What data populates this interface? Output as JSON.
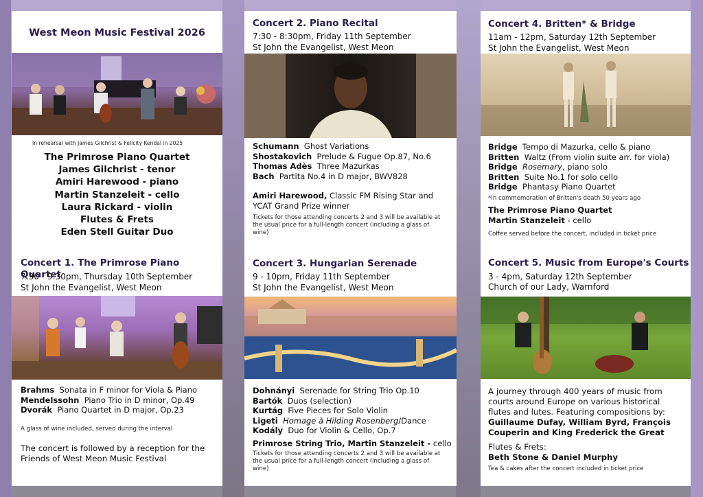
{
  "festival_title": "West Meon Music Festival 2026",
  "rehearsal_caption": "In rehearsal with James Gilchrist & Felicity Kendal in 2025",
  "lineup": [
    "The Primrose Piano Quartet",
    "James Gilchrist - tenor",
    "Amiri Harewood - piano",
    "Martin Stanzeleit - cello",
    "Laura Rickard - violin",
    "Flutes & Frets",
    "Eden Stell Guitar Duo"
  ],
  "concert1": {
    "title": "Concert 1. The Primrose Piano Quartet",
    "time": "7:30 - 9:30pm, Thursday 10th September",
    "venue": "St John the Evangelist, West Meon",
    "program": [
      {
        "composer": "Brahms",
        "work": "Sonata in F minor for Viola & Piano"
      },
      {
        "composer": "Mendelssohn",
        "work": "Piano Trio in D minor, Op.49"
      },
      {
        "composer": "Dvorák",
        "work": "Piano Quartet in D major, Op.23"
      }
    ],
    "note": "A glass of wine included, served during the interval",
    "reception": "The concert is followed by a reception for the Friends of West Meon Music Festival"
  },
  "concert2": {
    "title": "Concert 2. Piano Recital",
    "time": "7:30 - 8:30pm, Friday 11th September",
    "venue": "St John the Evangelist, West Meon",
    "program": [
      {
        "composer": "Schumann",
        "work": "Ghost Variations"
      },
      {
        "composer": "Shostakovich",
        "work": "Prelude & Fugue Op.87, No.6"
      },
      {
        "composer": "Thomas Adès",
        "work": "Three Mazurkas"
      },
      {
        "composer": "Bach",
        "work": "Partita No.4 in D major, BWV828"
      }
    ],
    "performer": "Amiri Harewood,",
    "performer_desc": "Classic FM Rising Star and YCAT Grand Prize winner",
    "ticket_note": "Tickets for those attending concerts 2 and 3 will be available at the usual price for a full-length concert (including a glass of wine)"
  },
  "concert3": {
    "title": "Concert 3. Hungarian Serenade",
    "time": "9 - 10pm, Friday 11th September",
    "venue": "St John the Evangelist, West Meon",
    "program": [
      {
        "composer": "Dohnányi",
        "work": "Serenade for String Trio Op.10"
      },
      {
        "composer": "Bartók",
        "work": "Duos (selection)"
      },
      {
        "composer": "Kurtág",
        "work": "Five Pieces for Solo Violin"
      },
      {
        "composer": "Ligeti",
        "work_italic": "Homage à Hilding Rosenberg",
        "work": "/Dance"
      },
      {
        "composer": "Kodály",
        "work": "Duo for Violin & Cello, Op.7"
      }
    ],
    "performers": "Primrose String Trio,  Martin Stanzeleit -",
    "performers_tail": "cello",
    "ticket_note": "Tickets for those attending concerts 2 and 3 will be available at the usual price for a full-length concert (including a glass of wine)"
  },
  "concert4": {
    "title": "Concert 4. Britten* & Bridge",
    "time": "11am - 12pm, Saturday 12th September",
    "venue": "St John the Evangelist, West Meon",
    "program": [
      {
        "composer": "Bridge",
        "work": "Tempo di Mazurka, cello & piano"
      },
      {
        "composer": "Britten",
        "work": "Waltz (From violin suite arr. for viola)"
      },
      {
        "composer": "Bridge",
        "work_italic": "Rosemary",
        "work": ", piano solo"
      },
      {
        "composer": "Britten",
        "work": "Suite No.1 for solo cello"
      },
      {
        "composer": "Bridge",
        "work": "Phantasy Piano Quartet"
      }
    ],
    "footnote": "*In commemoration of Britten's death 50 years ago",
    "performer1": "The Primrose Piano Quartet",
    "performer2": "Martin Stanzeleit",
    "performer2_tail": "- cello",
    "coffee": "Coffee served before the concert, included in ticket price"
  },
  "concert5": {
    "title": "Concert 5. Music from Europe's Courts",
    "time": "3 - 4pm, Saturday 12th September",
    "venue": "Church of our Lady, Warnford",
    "description": "A journey through 400 years of music from courts around Europe on various historical flutes and lutes. Featuring compositions by:",
    "composers": "Guillaume Dufay, William Byrd, François Couperin and King Frederick the Great",
    "flutes_label": "Flutes & Frets:",
    "flutes_names": "Beth Stone & Daniel Murphy",
    "tea": "Tea & cakes after the concert included in ticket price"
  }
}
